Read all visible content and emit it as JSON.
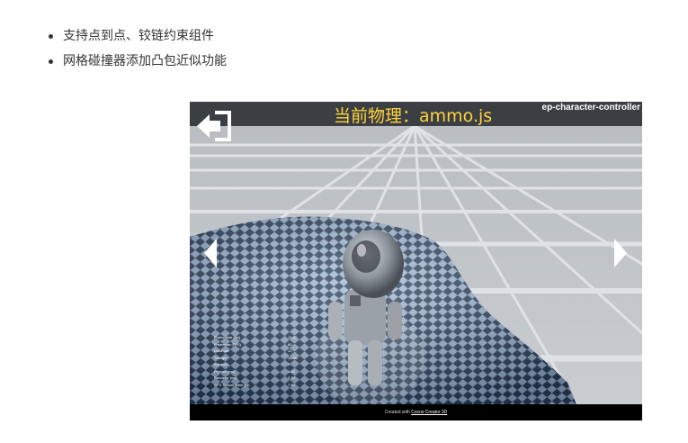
{
  "bullets": [
    "支持点到点、铰链约束组件",
    "网格碰撞器添加凸包近似功能"
  ],
  "demo": {
    "title": "当前物理：ammo.js",
    "project_name": "ep-character-controller",
    "title_color": "#ffd23a",
    "icons": {
      "exit": "exit-icon",
      "prev": "arrow-left-icon",
      "next": "arrow-right-icon"
    },
    "stats": [
      {
        "label": "Frame time (ms)",
        "value": "16.67"
      },
      {
        "label": "Framerate (FPS)",
        "value": "60"
      },
      {
        "label": "Draw call",
        "value": "12"
      },
      {
        "label": "Triangle",
        "value": "18432"
      },
      {
        "label": "Instance",
        "value": "0"
      },
      {
        "label": "Physics (ms)",
        "value": "1.32"
      },
      {
        "label": "Renderer (ms)",
        "value": "3.10"
      },
      {
        "label": "GFX Texture Mem (M)",
        "value": "7.80"
      }
    ],
    "footer_prefix": "Created with ",
    "footer_brand": "Cocos Creator 3D"
  }
}
